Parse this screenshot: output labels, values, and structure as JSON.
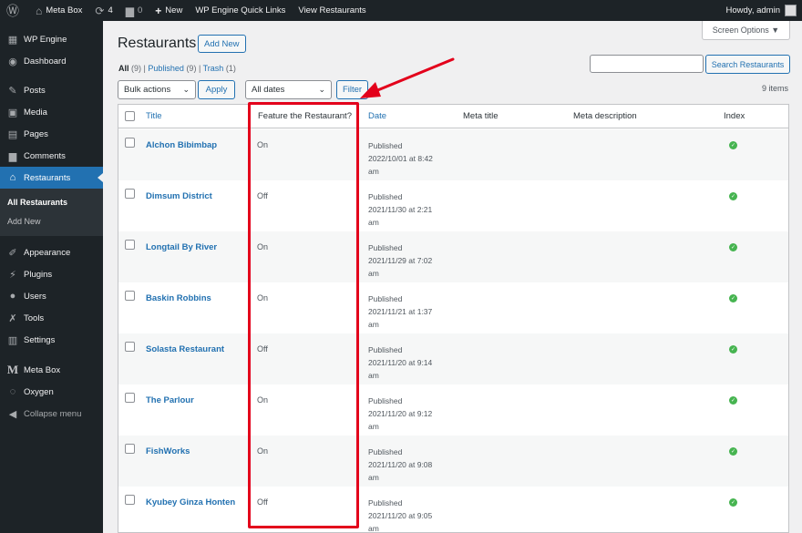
{
  "adminbar": {
    "site_name": "Meta Box",
    "updates_count": "4",
    "comments_count": "0",
    "new_label": "New",
    "wpengine_label": "WP Engine Quick Links",
    "view_label": "View Restaurants",
    "howdy": "Howdy, admin"
  },
  "sidebar": {
    "items": [
      {
        "label": "WP Engine",
        "icon": "grid-icon"
      },
      {
        "label": "Dashboard",
        "icon": "palette-icon"
      },
      {
        "label": "Posts",
        "icon": "pin-icon"
      },
      {
        "label": "Media",
        "icon": "media-icon"
      },
      {
        "label": "Pages",
        "icon": "pages-icon"
      },
      {
        "label": "Comments",
        "icon": "comment-icon"
      },
      {
        "label": "Restaurants",
        "icon": "home-icon"
      },
      {
        "label": "Appearance",
        "icon": "brush-icon"
      },
      {
        "label": "Plugins",
        "icon": "plug-icon"
      },
      {
        "label": "Users",
        "icon": "user-icon"
      },
      {
        "label": "Tools",
        "icon": "wrench-icon"
      },
      {
        "label": "Settings",
        "icon": "sliders-icon"
      },
      {
        "label": "Meta Box",
        "icon": "metabox-icon"
      },
      {
        "label": "Oxygen",
        "icon": "oxygen-icon"
      },
      {
        "label": "Collapse menu",
        "icon": "collapse-icon"
      }
    ],
    "submenu": [
      {
        "label": "All Restaurants"
      },
      {
        "label": "Add New"
      }
    ]
  },
  "page": {
    "title": "Restaurants",
    "add_new": "Add New",
    "screen_options": "Screen Options ▼",
    "views": {
      "all": "All",
      "all_count": "(9)",
      "published": "Published",
      "published_count": "(9)",
      "trash": "Trash",
      "trash_count": "(1)"
    },
    "search_button": "Search Restaurants",
    "bulk_actions": "Bulk actions",
    "apply": "Apply",
    "all_dates": "All dates",
    "filter": "Filter",
    "items_count": "9 items"
  },
  "table": {
    "columns": [
      "Title",
      "Feature the Restaurant?",
      "Date",
      "Meta title",
      "Meta description",
      "Index"
    ],
    "rows": [
      {
        "title": "Alchon Bibimbap",
        "feature": "On",
        "status": "Published",
        "date": "2022/10/01 at 8:42",
        "ampm": "am"
      },
      {
        "title": "Dimsum District",
        "feature": "Off",
        "status": "Published",
        "date": "2021/11/30 at 2:21",
        "ampm": "am"
      },
      {
        "title": "Longtail By River",
        "feature": "On",
        "status": "Published",
        "date": "2021/11/29 at 7:02",
        "ampm": "am"
      },
      {
        "title": "Baskin Robbins",
        "feature": "On",
        "status": "Published",
        "date": "2021/11/21 at 1:37",
        "ampm": "am"
      },
      {
        "title": "Solasta Restaurant",
        "feature": "Off",
        "status": "Published",
        "date": "2021/11/20 at 9:14",
        "ampm": "am"
      },
      {
        "title": "The Parlour",
        "feature": "On",
        "status": "Published",
        "date": "2021/11/20 at 9:12",
        "ampm": "am"
      },
      {
        "title": "FishWorks",
        "feature": "On",
        "status": "Published",
        "date": "2021/11/20 at 9:08",
        "ampm": "am"
      },
      {
        "title": "Kyubey Ginza Honten",
        "feature": "Off",
        "status": "Published",
        "date": "2021/11/20 at 9:05",
        "ampm": "am"
      }
    ]
  },
  "colors": {
    "accent": "#2271b1",
    "highlight": "#e3001b",
    "index_good": "#46b450"
  }
}
